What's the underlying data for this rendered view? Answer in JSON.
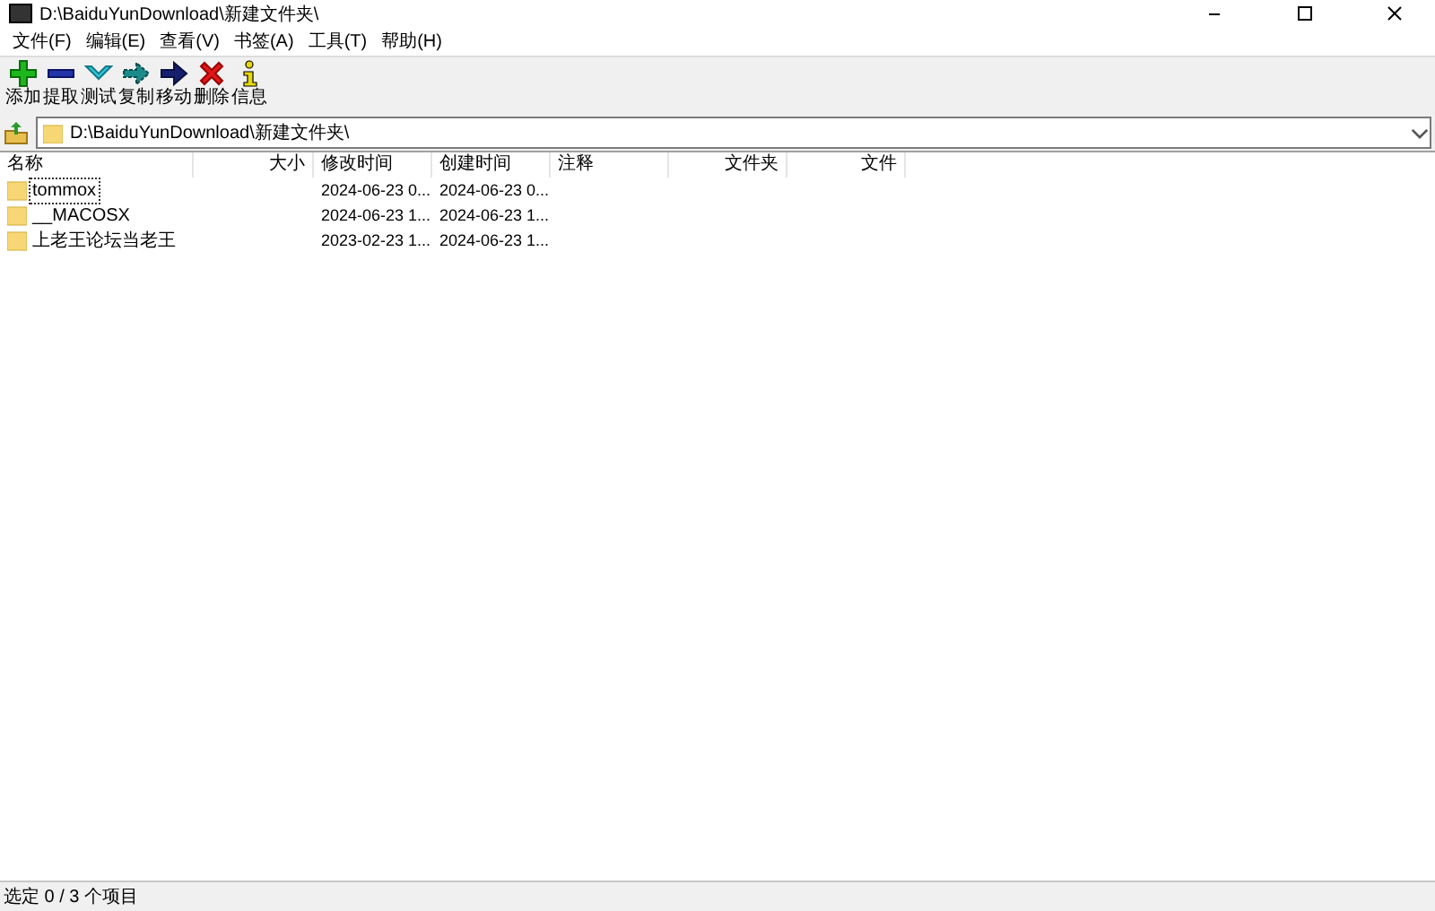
{
  "window": {
    "title": "D:\\BaiduYunDownload\\新建文件夹\\"
  },
  "menu": [
    "文件(F)",
    "编辑(E)",
    "查看(V)",
    "书签(A)",
    "工具(T)",
    "帮助(H)"
  ],
  "toolbar": [
    {
      "kind": "add",
      "label": "添加"
    },
    {
      "kind": "extract",
      "label": "提取"
    },
    {
      "kind": "test",
      "label": "测试"
    },
    {
      "kind": "copy",
      "label": "复制"
    },
    {
      "kind": "move",
      "label": "移动"
    },
    {
      "kind": "delete",
      "label": "删除"
    },
    {
      "kind": "info",
      "label": "信息"
    }
  ],
  "address": {
    "value": "D:\\BaiduYunDownload\\新建文件夹\\"
  },
  "table": {
    "columns": [
      "名称",
      "大小",
      "修改时间",
      "创建时间",
      "注释",
      "文件夹",
      "文件"
    ],
    "rows": [
      {
        "name": "tommox",
        "modified": "2024-06-23 0...",
        "created": "2024-06-23 0...",
        "focused": true
      },
      {
        "name": "__MACOSX",
        "modified": "2024-06-23 1...",
        "created": "2024-06-23 1...",
        "focused": false
      },
      {
        "name": "上老王论坛当老王",
        "modified": "2023-02-23 1...",
        "created": "2024-06-23 1...",
        "focused": false
      }
    ]
  },
  "status_bar": "选定 0 / 3 个项目"
}
